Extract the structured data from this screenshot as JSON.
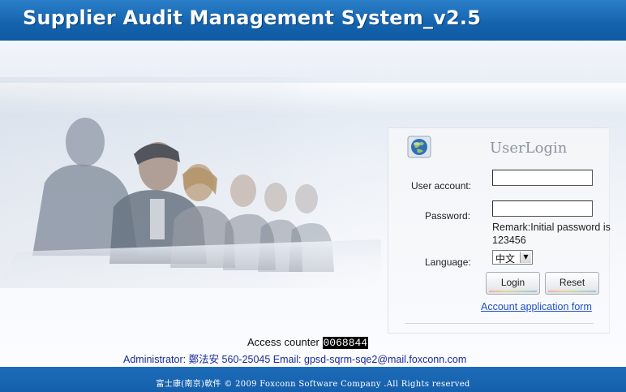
{
  "header": {
    "title": "Supplier Audit Management System_v2.5"
  },
  "login": {
    "title": "UserLogin",
    "user_account_label": "User account:",
    "user_account_value": "",
    "password_label": "Password:",
    "password_value": "",
    "remark": "Remark:Initial password is 123456",
    "language_label": "Language:",
    "language_value": "中文",
    "login_button": "Login",
    "reset_button": "Reset",
    "application_link": "Account application form"
  },
  "counter": {
    "label": "Access counter",
    "value": "0068844"
  },
  "admin_info": "Administrator: 鄭法安 560-25045 Email: gpsd-sqrm-sqe2@mail.foxconn.com",
  "footer": {
    "copyright": "富士康(南京)軟件 © 2009 Foxconn Software Company .All Rights reserved"
  },
  "colors": {
    "header_blue": "#1462ad",
    "link_blue": "#1e4fc8",
    "admin_text": "#1a2a9a"
  }
}
